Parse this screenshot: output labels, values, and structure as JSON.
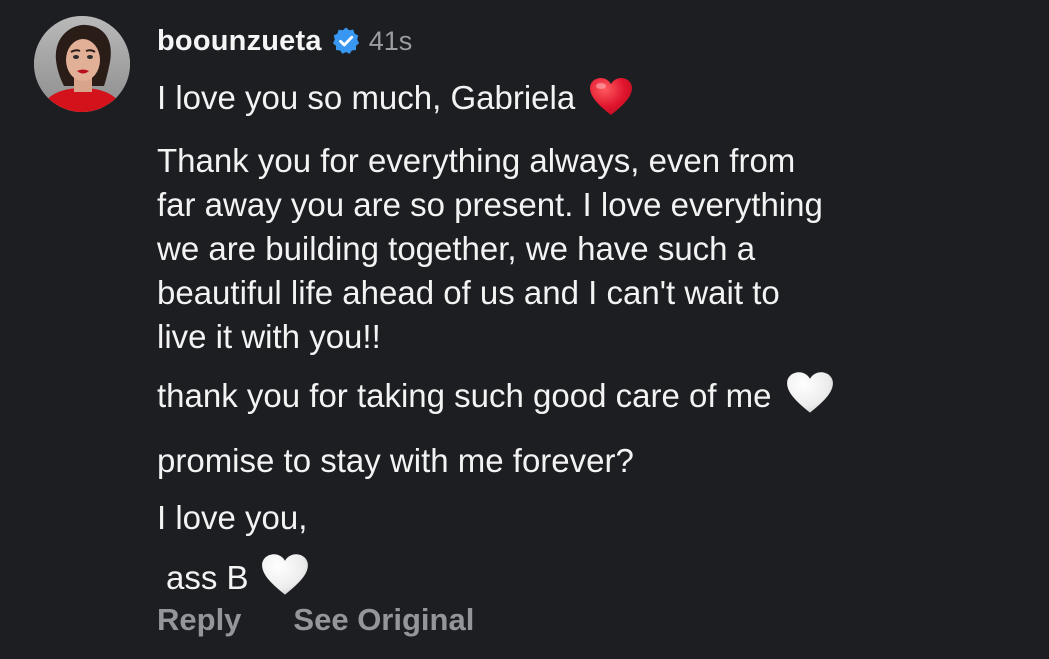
{
  "comment": {
    "username": "boounzueta",
    "verified_icon": "verified-badge-icon",
    "timestamp": "41s",
    "paragraphs": [
      "I love you so much, Gabriela",
      "Thank you for everything always, even from\nfar away you are so present. I love everything\nwe are building together, we have such a\nbeautiful life ahead of us and I can't wait to\nlive it with you!!",
      "thank you for taking such good care of me",
      "promise to stay with me forever?",
      "I love you,",
      "ass B"
    ],
    "emojis": {
      "red_heart": "red-heart-icon",
      "white_heart": "white-heart-icon"
    }
  },
  "actions": {
    "reply_label": "Reply",
    "see_original_label": "See Original"
  },
  "colors": {
    "background": "#1c1e22",
    "text": "#f3f3f3",
    "muted": "#94969b",
    "verified_blue": "#3897f0",
    "heart_red": "#e0152d"
  }
}
